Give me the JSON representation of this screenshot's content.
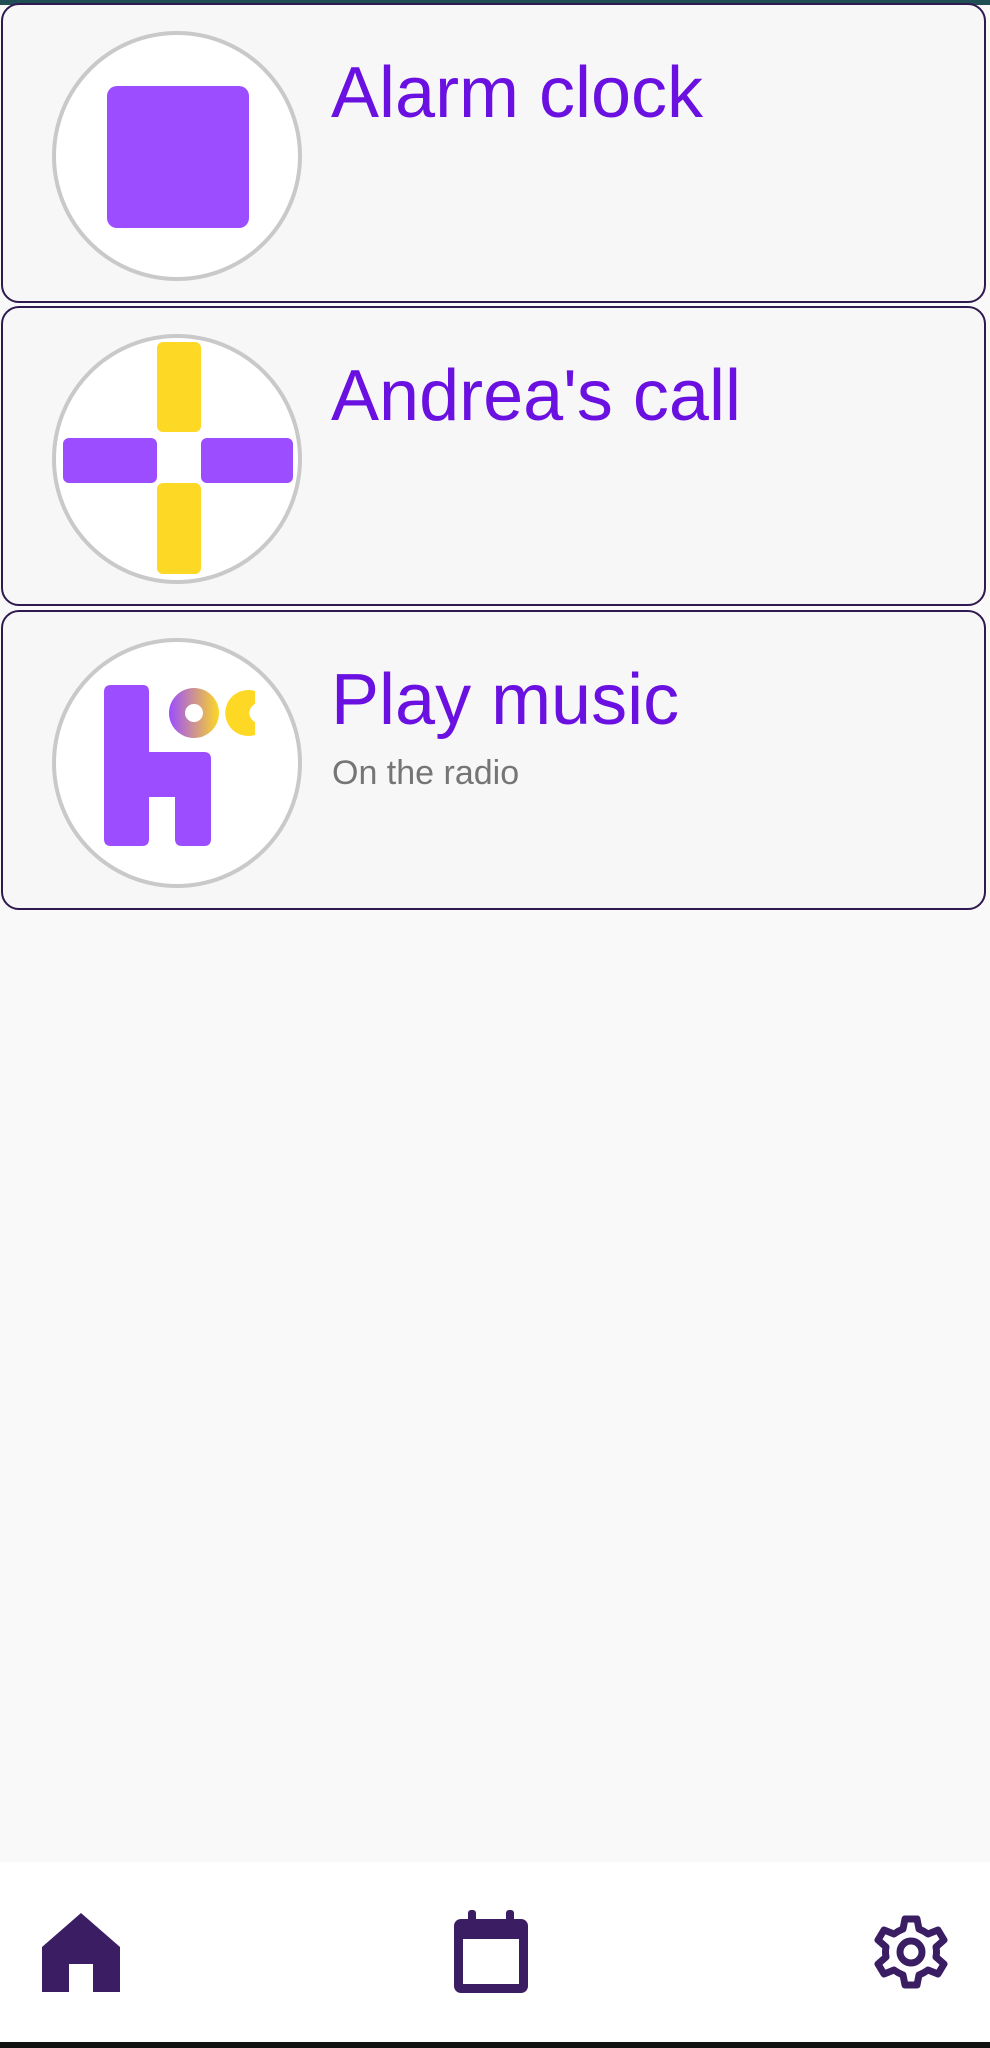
{
  "items": [
    {
      "title": "Alarm clock",
      "subtitle": "",
      "icon": "alarm-clock-icon"
    },
    {
      "title": "Andrea's call",
      "subtitle": "",
      "icon": "call-icon"
    },
    {
      "title": "Play music",
      "subtitle": "On the radio",
      "icon": "music-icon"
    }
  ],
  "bottom_nav": [
    {
      "name": "home",
      "icon": "home-icon",
      "active": true
    },
    {
      "name": "calendar",
      "icon": "calendar-icon",
      "active": false
    },
    {
      "name": "settings",
      "icon": "gear-icon",
      "active": false
    }
  ],
  "colors": {
    "title": "#6a10e0",
    "subtitle": "#757575",
    "accent_purple": "#9b4dff",
    "accent_yellow": "#fdd825",
    "nav_icon": "#3a1d63",
    "card_border": "#2e1a4f",
    "background": "#f9f9f9"
  }
}
